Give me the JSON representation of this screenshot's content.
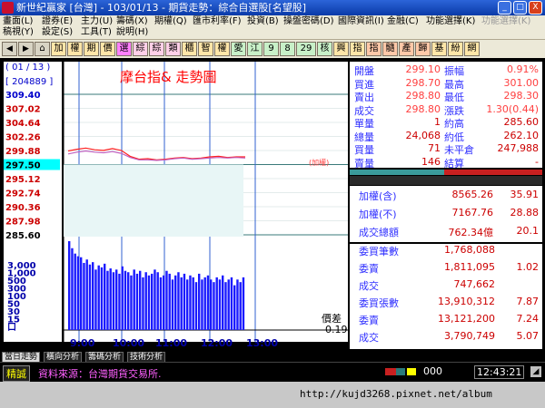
{
  "window": {
    "title": "新世紀贏家 [台灣] - 103/01/13 - 期貨走勢：綜合自選股[名望股]",
    "minimize": "_",
    "maximize": "□",
    "close": "X"
  },
  "menu": {
    "row1": [
      "畫面(L)",
      "證券(E)",
      "主力(U)",
      "籌碼(X)",
      "期權(Q)",
      "匯市利率(F)",
      "投資(B)",
      "操盤密碼(D)",
      "國際資訊(I)",
      "金融(C)",
      "功能選擇(K)",
      "功能選擇(K)"
    ],
    "row2": [
      "稿視(Y)",
      "設定(S)",
      "工具(T)",
      "說明(H)"
    ]
  },
  "toolbar": {
    "buttons": [
      "加",
      "權",
      "期",
      "價",
      "選",
      "綜",
      "綜",
      "類",
      "櫃",
      "智",
      "權",
      "愛",
      "江",
      "9",
      "8",
      "29",
      "核",
      "興",
      "指",
      "指",
      "髓",
      "產",
      "歸",
      "基",
      "紛",
      "網"
    ]
  },
  "chart": {
    "title": "摩台指& 走勢圖",
    "page_indicator": "( 01 / 13 )",
    "volume_label": "[ 204889 ]",
    "ref_label": "(加權)",
    "diff_label": "價差",
    "diff_value": "-0.19",
    "price_ticks": [
      {
        "label": "309.40",
        "value": 309.4,
        "color": "#00ffff"
      },
      {
        "label": "307.02",
        "value": 307.02,
        "color": "#ff4040"
      },
      {
        "label": "304.64",
        "value": 304.64,
        "color": "#ff4040"
      },
      {
        "label": "302.26",
        "value": 302.26,
        "color": "#ff4040"
      },
      {
        "label": "299.88",
        "value": 299.88,
        "color": "#ff4040"
      },
      {
        "label": "297.50",
        "value": 297.5,
        "color": "#ffffff"
      },
      {
        "label": "295.12",
        "value": 295.12,
        "color": "#ff4040"
      },
      {
        "label": "292.74",
        "value": 292.74,
        "color": "#ff4040"
      },
      {
        "label": "290.36",
        "value": 290.36,
        "color": "#ff4040"
      },
      {
        "label": "287.98",
        "value": 287.98,
        "color": "#ff4040"
      },
      {
        "label": "285.60",
        "value": 285.6,
        "color": "#ffffff"
      }
    ],
    "volume_ticks": [
      "3,000",
      "1,000",
      "500",
      "300",
      "100",
      "50",
      "30",
      "15",
      "口"
    ],
    "time_ticks": [
      "9:00",
      "10:00",
      "11:00",
      "12:00",
      "13:00"
    ],
    "price_range": [
      285.6,
      309.4
    ],
    "reference_price": 297.5
  },
  "chart_data": {
    "type": "line",
    "x": [
      "8:45",
      "9:00",
      "9:15",
      "9:30",
      "9:45",
      "10:00",
      "10:15",
      "10:30",
      "10:45",
      "11:00",
      "11:15",
      "11:30",
      "11:45",
      "12:00",
      "12:15",
      "12:30",
      "12:45",
      "13:00",
      "13:15",
      "13:30",
      "13:45"
    ],
    "series": [
      {
        "values": [
          299.8,
          300.1,
          300.3,
          300.0,
          299.9,
          300.2,
          299.9,
          298.9,
          298.4,
          298.5,
          298.3,
          298.4,
          298.6,
          298.7,
          298.5,
          298.6,
          298.8,
          298.9,
          298.7,
          298.8,
          298.8
        ]
      },
      {
        "values": [
          299.3,
          299.6,
          299.8,
          299.6,
          299.5,
          299.7,
          299.4,
          298.7,
          298.3,
          298.3,
          298.2,
          298.3,
          298.5,
          298.6,
          298.4,
          298.5,
          298.6,
          298.7,
          298.6,
          298.7,
          298.6
        ]
      }
    ],
    "volume_bars": [
      420,
      260,
      180,
      150,
      140,
      95,
      120,
      85,
      100,
      60,
      80,
      70,
      90,
      55,
      65,
      50,
      60,
      45,
      75,
      55,
      50,
      40,
      60,
      45,
      55,
      35,
      50,
      40,
      45,
      60,
      50,
      35,
      40,
      55,
      45,
      30,
      40,
      50,
      35,
      45,
      30,
      40,
      35,
      25,
      45,
      30,
      35,
      40,
      30,
      25,
      35,
      30,
      40,
      25,
      30,
      35,
      20,
      30,
      25,
      35
    ],
    "ylim": [
      285.6,
      309.4
    ]
  },
  "quote": {
    "rows": [
      {
        "l1": "開盤",
        "v1": "299.10",
        "c1": "#ff4040",
        "l2": "振幅",
        "v2": "0.91%",
        "c2": "#ff4040"
      },
      {
        "l1": "買進",
        "v1": "298.70",
        "c1": "#ff4040",
        "l2": "最高",
        "v2": "301.00",
        "c2": "#ff4040"
      },
      {
        "l1": "賣出",
        "v1": "298.80",
        "c1": "#ff4040",
        "l2": "最低",
        "v2": "298.30",
        "c2": "#ff4040"
      },
      {
        "l1": "成交",
        "v1": "298.80",
        "c1": "#ff4040",
        "l2": "漲跌",
        "v2": "1.30(0.44)",
        "c2": "#ff4040"
      },
      {
        "l1": "單量",
        "v1": "1",
        "c1": "#ffff00",
        "l2": "約高",
        "v2": "285.60",
        "c2": "#ffff00"
      },
      {
        "l1": "總量",
        "v1": "24,068",
        "c1": "#ffff00",
        "l2": "約低",
        "v2": "262.10",
        "c2": "#ffff00"
      },
      {
        "l1": "買量",
        "v1": "71",
        "c1": "#ffff00",
        "l2": "未平倉",
        "v2": "247,988",
        "c2": "#ffff00"
      },
      {
        "l1": "賣量",
        "v1": "146",
        "c1": "#ffff00",
        "l2": "結算",
        "v2": "-",
        "c2": "#ffff00"
      }
    ]
  },
  "index": {
    "rows": [
      {
        "label": "加權(含)",
        "value": "8565.26",
        "change": "35.91"
      },
      {
        "label": "加權(不)",
        "value": "7167.76",
        "change": "28.88"
      },
      {
        "label": "成交總額",
        "value": "762.34億",
        "change": "20.1"
      }
    ]
  },
  "orders": {
    "rows": [
      {
        "label": "委買筆數",
        "value": "1,768,088",
        "change": ""
      },
      {
        "label": "委賣",
        "value": "1,811,095",
        "change": "1.02"
      },
      {
        "label": "成交",
        "value": "747,662",
        "change": ""
      },
      {
        "label": "委買張數",
        "value": "13,910,312",
        "change": "7.87"
      },
      {
        "label": "委賣",
        "value": "13,121,200",
        "change": "7.24"
      },
      {
        "label": "成交",
        "value": "3,790,749",
        "change": "5.07"
      }
    ]
  },
  "tabs": [
    "當日走勢",
    "橫向分析",
    "籌碼分析",
    "技術分析"
  ],
  "status": {
    "mode": "精誠",
    "source": "資料來源：台灣期貨交易所.",
    "counter": "000",
    "clock": "12:43:21"
  },
  "footer": {
    "url": "http://kujd3268.pixnet.net/album"
  },
  "colors": {
    "up": "#ff4040",
    "neutral": "#ffff00",
    "label_blue": "#3030ff",
    "volume": "#1a1aff",
    "chart_bg": "#e8f6f6",
    "accent_yellow": "#ffff00"
  }
}
